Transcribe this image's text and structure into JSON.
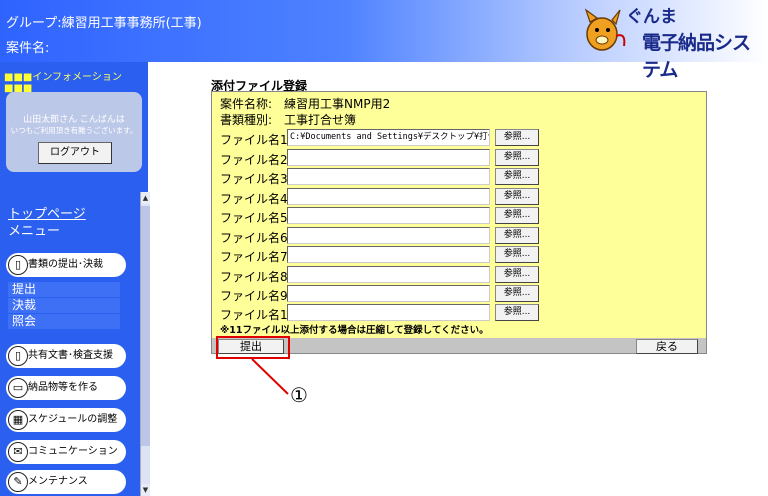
{
  "header": {
    "group": "グループ:練習用工事事務所(工事)",
    "case_name": "案件名:",
    "logo_line1": "ぐんま",
    "logo_line2": "電子納品システム"
  },
  "sidebar": {
    "info_label": "インフォメーション",
    "greeting": "山田太郎さん こんばんは",
    "greeting_sub": "いつもご利用頂き有難うございます。",
    "logout_label": "ログアウト",
    "top_page": "トップページ",
    "menu_label": "メニュー",
    "menu_docs": "書類の提出･決裁",
    "sub_items": [
      "提出",
      "決裁",
      "照会"
    ],
    "menu_shared": "共有文書･検査支援",
    "menu_deliver": "納品物等を作る",
    "menu_schedule": "スケジュールの調整",
    "menu_comm": "コミュニケーション",
    "menu_maint": "メンテナンス"
  },
  "main": {
    "title": "添付ファイル登録",
    "case_name": "案件名称:　練習用工事NMP用2",
    "doc_type": "書類種別:　工事打合せ簿",
    "files": [
      {
        "label": "ファイル名1",
        "value": "C:¥Documents and Settings¥デスクトップ¥打合せ"
      },
      {
        "label": "ファイル名2",
        "value": ""
      },
      {
        "label": "ファイル名3",
        "value": ""
      },
      {
        "label": "ファイル名4",
        "value": ""
      },
      {
        "label": "ファイル名5",
        "value": ""
      },
      {
        "label": "ファイル名6",
        "value": ""
      },
      {
        "label": "ファイル名7",
        "value": ""
      },
      {
        "label": "ファイル名8",
        "value": ""
      },
      {
        "label": "ファイル名9",
        "value": ""
      },
      {
        "label": "ファイル名10",
        "value": ""
      }
    ],
    "browse_label": "参照...",
    "note": "※11ファイル以上添付する場合は圧縮して登録してください。",
    "submit_label": "提出",
    "back_label": "戻る"
  },
  "annotation": {
    "number": "①"
  },
  "colors": {
    "sidebar": "#2a5fef",
    "panel": "#ffff99",
    "highlight": "#e00000"
  }
}
